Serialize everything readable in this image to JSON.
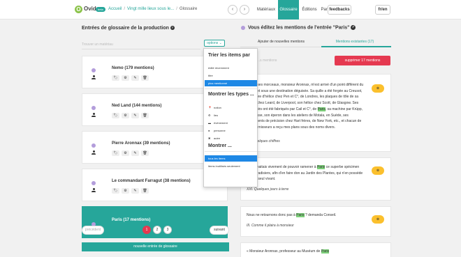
{
  "navbar": {
    "logo_letter": "O",
    "brand": "Ovide",
    "beta": "beta",
    "breadcrumb_home": "Accueil",
    "breadcrumb_project": "Vingt mille lieux sous le...",
    "breadcrumb_current": "Glossaire",
    "prev_icon": "‹",
    "next_icon": "›",
    "menu": [
      "Matériaux",
      "Glossaire",
      "Éditions",
      "Paramètres"
    ],
    "feedbacks": "feedbacks",
    "lang": "fr/en"
  },
  "left": {
    "title": "Entrées de glossaire de la production",
    "help_icon": "?",
    "filter_placeholder": "Trouver un matériau",
    "options_label": "options ⌄",
    "entries": [
      {
        "name": "Nemo (179 mentions)"
      },
      {
        "name": "Ned Land (144 mentions)"
      },
      {
        "name": "Pierre Aronnax (39 mentions)"
      },
      {
        "name": "Le commandant Farragut (38 mentions)"
      },
      {
        "name": "Paris (17 mentions)"
      }
    ],
    "action_icons": [
      "🏷",
      "⚙",
      "✎",
      "🗑"
    ],
    "pagination": {
      "prev": "précédent",
      "pages": [
        "1",
        "2",
        "3"
      ],
      "active_page": "1",
      "next": "suivant"
    },
    "new_entry": "nouvelle entrée de glossaire"
  },
  "dropdown": {
    "sort_header": "Trier les items par",
    "sort_options": [
      "édité récemment",
      "titre",
      "plus mentionné"
    ],
    "sort_selected": "plus mentionné",
    "types_header": "Montrer les types ...",
    "types": [
      {
        "icon": "📍",
        "label": "notion"
      },
      {
        "icon": "⚙",
        "label": "lieu"
      },
      {
        "icon": "▬",
        "label": "événement"
      },
      {
        "icon": "●",
        "label": "personne"
      },
      {
        "icon": "✖",
        "label": "autre"
      }
    ],
    "show_header": "Montrer ...",
    "show_options": [
      "tous les items",
      "items inutilisés seulement"
    ],
    "show_selected": "tous les items"
  },
  "right": {
    "title": "Vous éditez les mentions de l'entrée \"Paris\"",
    "title_icon": "✓",
    "tabs": [
      "Ajouter de nouvelles mentions",
      "Mentions existantes (17)"
    ],
    "active_tab": "Mentions existantes (17)",
    "search_placeholder": "...s mentions",
    "remove_all": "supprimer 17 mentions",
    "mentions": [
      {
        "before": "...e de ses morceaux, monsieur Aronnax, m'est arrivé d'un point différent du globe, et sous une destination déguisée. Sa quille a été forgée au Creusot, son arbre d'hélice chez Pen et C°, de Londres, les plaques de tôle de sa coque chez Leard, de Liverpool, son hélice chez Scott, de Glasgow. Ses réservoirs ont été fabriqués par Cail et C°, de ",
        "highlight": "Paris",
        "after": ", sa machine par Krüpp, en Prusse, son éperon dans les ateliers de Motala, en Suède, ses instruments de précision chez Hart frères, de New York, etc., et chacun de ces fournisseurs a reçu mes plans sous des noms divers.",
        "source": "XII. Quelques chiffres",
        "button_icon": "⊗"
      },
      {
        "before": "Je souhaitais vivement de pouvoir ramener à ",
        "highlight": "Paris",
        "after": " ce superbe spécimen des paradisiers, afin d'en faire don au Jardin des Plantes, qui n'en possède pas un seul vivant.",
        "source": "XXI. Quelques jours à terre",
        "button_icon": "⊗"
      },
      {
        "before": "Nous ne retournons donc pas à ",
        "highlight": "Paris",
        "after": " ? demanda Conseil.",
        "source": "III. Comme il plaira à monsieur",
        "button_icon": "⊗"
      },
      {
        "before": "« Monsieur Aronnax, professeur au Muséum de ",
        "highlight": "Paris",
        "after": "",
        "source": "",
        "button_icon": ""
      }
    ]
  }
}
